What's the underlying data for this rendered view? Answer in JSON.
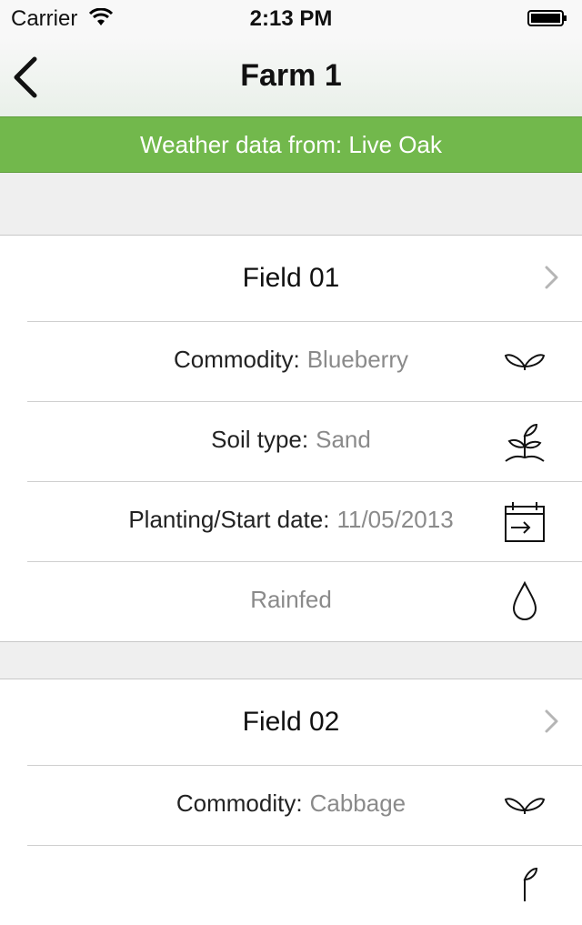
{
  "status_bar": {
    "carrier": "Carrier",
    "time": "2:13 PM"
  },
  "nav": {
    "title": "Farm 1"
  },
  "weather_banner": {
    "text": "Weather data from: Live Oak"
  },
  "fields": [
    {
      "name": "Field 01",
      "commodity_label": "Commodity:",
      "commodity": "Blueberry",
      "soil_label": "Soil type:",
      "soil": "Sand",
      "date_label": "Planting/Start date:",
      "date": "11/05/2013",
      "irrigation": "Rainfed"
    },
    {
      "name": "Field 02",
      "commodity_label": "Commodity:",
      "commodity": "Cabbage"
    }
  ],
  "colors": {
    "banner": "#72b84c",
    "value_text": "#8a8a8a",
    "background": "#efefef"
  },
  "icons": [
    "back-chevron-icon",
    "wifi-icon",
    "battery-icon",
    "chevron-right-icon",
    "leaves-icon",
    "sprout-icon",
    "calendar-icon",
    "water-drop-icon"
  ]
}
